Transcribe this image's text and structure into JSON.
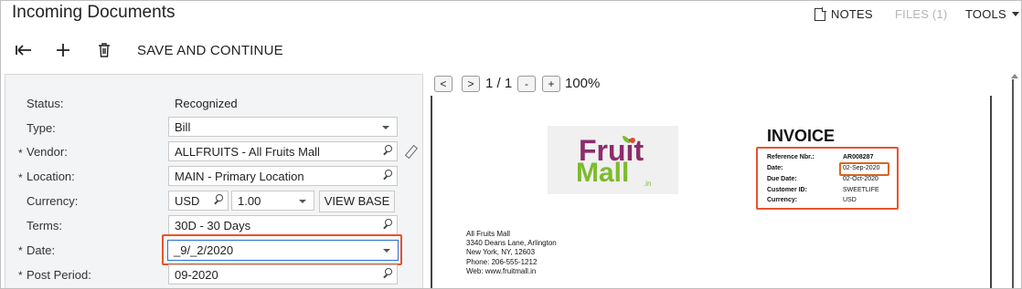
{
  "header": {
    "title": "Incoming Documents",
    "notes_label": "NOTES",
    "files_label": "FILES (1)",
    "tools_label": "TOOLS"
  },
  "toolbar": {
    "save_continue_label": "SAVE AND CONTINUE",
    "back_icon": "undo-arrow-icon",
    "add_icon": "plus-icon",
    "delete_icon": "trash-icon"
  },
  "form": {
    "status": {
      "label": "Status:",
      "value": "Recognized"
    },
    "type": {
      "label": "Type:",
      "value": "Bill"
    },
    "vendor": {
      "label": "Vendor:",
      "value": "ALLFRUITS - All Fruits Mall"
    },
    "location": {
      "label": "Location:",
      "value": "MAIN - Primary Location"
    },
    "currency": {
      "label": "Currency:",
      "code": "USD",
      "rate": "1.00",
      "view_base_label": "VIEW BASE"
    },
    "terms": {
      "label": "Terms:",
      "value": "30D - 30 Days"
    },
    "date": {
      "label": "Date:",
      "value": "_9/_2/2020"
    },
    "post_period": {
      "label": "Post Period:",
      "value": "09-2020"
    },
    "required_marker": "*"
  },
  "viewer": {
    "prev_label": "<",
    "next_label": ">",
    "page_info": "1 / 1",
    "zoom_out_label": "-",
    "zoom_in_label": "+",
    "zoom": "100%"
  },
  "invoice": {
    "logo_text_1": "Fruit",
    "logo_text_2": "Mall",
    "logo_suffix": ".in",
    "title": "INVOICE",
    "rows": [
      {
        "label": "Reference Nbr.:",
        "value": "AR008287"
      },
      {
        "label": "Date:",
        "value": "02-Sep-2020"
      },
      {
        "label": "Due Date:",
        "value": "02-Oct-2020"
      },
      {
        "label": "Customer ID:",
        "value": "SWEETLIFE"
      },
      {
        "label": "Currency:",
        "value": "USD"
      }
    ],
    "address": [
      "All Fruits Mall",
      "3340 Deans Lane, Arlington",
      "New York, NY, 12603",
      "Phone: 206-555-1212",
      "Web: www.fruitmall.in"
    ]
  },
  "colors": {
    "highlight": "#e8532d",
    "date_highlight": "#d8661e",
    "logo_purple": "#8c2d6b",
    "logo_green": "#7dbb2c"
  }
}
